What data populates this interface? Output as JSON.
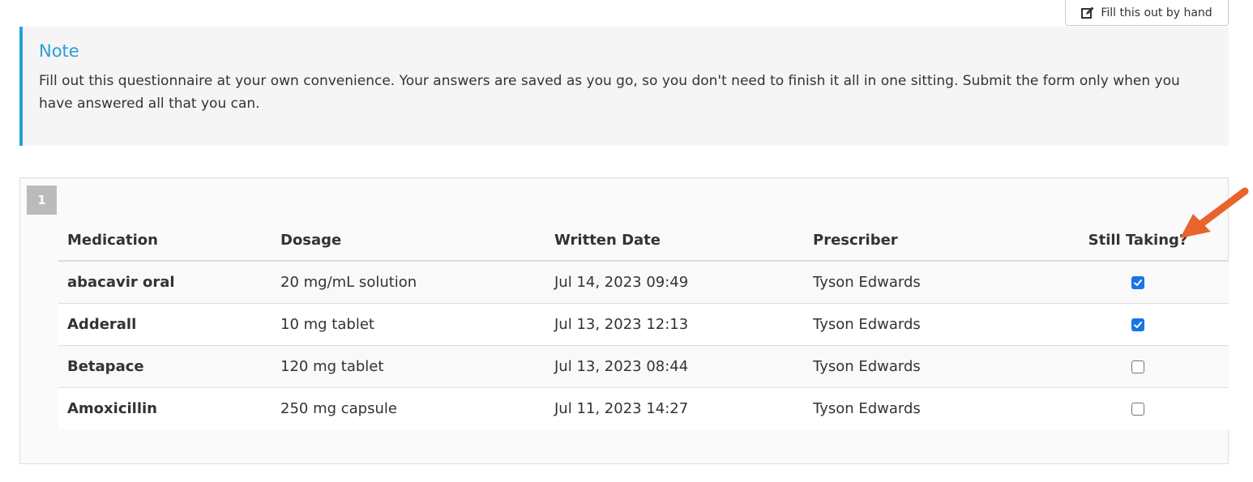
{
  "toolbar": {
    "fill_by_hand_label": "Fill this out by hand",
    "fill_by_hand_icon": "edit-icon"
  },
  "note": {
    "title": "Note",
    "body": "Fill out this questionnaire at your own convenience. Your answers are saved as you go, so you don't need to finish it all in one sitting. Submit the form only when you have answered all that you can.",
    "accent_color": "#2a9fd6"
  },
  "question": {
    "number": "1",
    "columns": [
      "Medication",
      "Dosage",
      "Written Date",
      "Prescriber",
      "Still Taking?"
    ],
    "rows": [
      {
        "medication": "abacavir oral",
        "dosage": "20 mg/mL solution",
        "written_date": "Jul 14, 2023 09:49",
        "prescriber": "Tyson Edwards",
        "still_taking": true
      },
      {
        "medication": "Adderall",
        "dosage": "10 mg tablet",
        "written_date": "Jul 13, 2023 12:13",
        "prescriber": "Tyson Edwards",
        "still_taking": true
      },
      {
        "medication": "Betapace",
        "dosage": "120 mg tablet",
        "written_date": "Jul 13, 2023 08:44",
        "prescriber": "Tyson Edwards",
        "still_taking": false
      },
      {
        "medication": "Amoxicillin",
        "dosage": "250 mg capsule",
        "written_date": "Jul 11, 2023 14:27",
        "prescriber": "Tyson Edwards",
        "still_taking": false
      }
    ]
  },
  "annotation": {
    "arrow_color": "#e8642c",
    "arrow_icon": "arrow-pointer-icon"
  }
}
